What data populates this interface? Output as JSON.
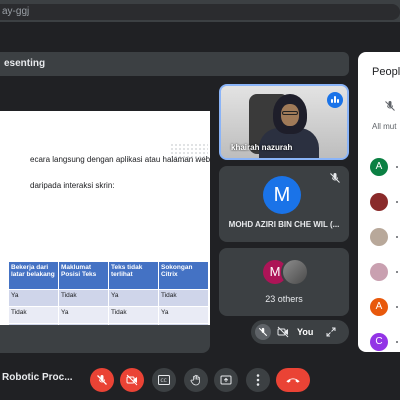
{
  "browser": {
    "url_fragment": "ay-ggj"
  },
  "presenting_bar": {
    "label": "esenting"
  },
  "slide": {
    "line1": "ecara langsung dengan aplikasi atau halaman web yang",
    "line2": "daripada interaksi skrin:",
    "table_headers": [
      "Bekerja dari latar belakang",
      "Maklumat Posisi Teks",
      "Teks tidak terlihat",
      "Sokongan Citrix"
    ],
    "table_rows": [
      [
        "Ya",
        "Tidak",
        "Ya",
        "Tidak"
      ],
      [
        "Tidak",
        "Ya",
        "Tidak",
        "Ya"
      ],
      [
        "Tidak",
        "Ya",
        "Tidak",
        "Ya"
      ]
    ]
  },
  "tiles": {
    "speaker_name": "khairah nazurah",
    "m_initial": "M",
    "m_name": "MOHD AZIRI BIN CHE WIL (...",
    "others_initial": "M",
    "others_count": "23 others",
    "self_label": "You"
  },
  "people_panel": {
    "title": "People",
    "mute_all_label": "All mut",
    "avatars": [
      {
        "initial": "A",
        "color": "#0b8043"
      },
      {
        "initial": "",
        "color": "#8a2a2a"
      },
      {
        "initial": "",
        "color": "#b8a89a"
      },
      {
        "initial": "",
        "color": "#c9a0b0"
      },
      {
        "initial": "A",
        "color": "#e8590c"
      },
      {
        "initial": "C",
        "color": "#9334e6"
      }
    ]
  },
  "bottom_bar": {
    "meeting_name": "Robotic Proc...",
    "buttons": [
      "mic-off",
      "camera-off",
      "captions",
      "raise-hand",
      "present-now",
      "more-options",
      "leave-call"
    ]
  },
  "colors": {
    "accent": "#1a73e8",
    "danger": "#ea4335",
    "table_header": "#4472c4"
  }
}
